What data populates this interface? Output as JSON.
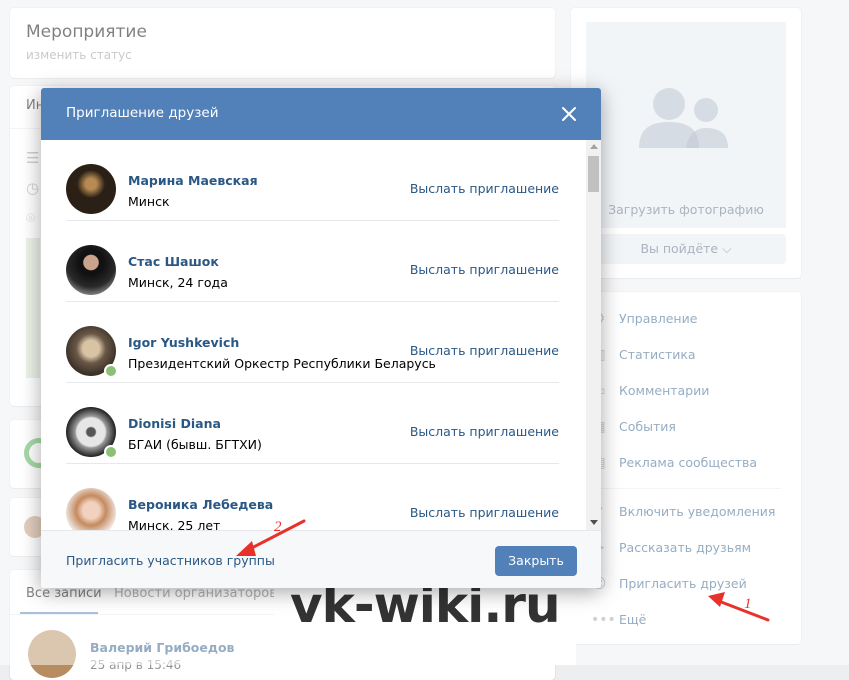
{
  "event": {
    "title": "Мероприятие",
    "status_link": "изменить статус",
    "info_prefix": "Ин"
  },
  "wall": {
    "tabs": [
      "Все записи",
      "Новости организаторов"
    ],
    "post_author": "Валерий Грибоедов",
    "post_date": "25 апр в 15:46"
  },
  "photo": {
    "upload_label": "Загрузить фотографию",
    "go_button": "Вы пойдёте ⌵"
  },
  "menu": {
    "items": [
      "Управление",
      "Статистика",
      "Комментарии",
      "События",
      "Реклама сообщества",
      "Включить уведомления",
      "Рассказать друзьям",
      "Пригласить друзей",
      "Ещё"
    ],
    "icons": [
      "gear-icon",
      "chart-icon",
      "comments-icon",
      "events-icon",
      "ads-icon",
      "bell-icon",
      "megaphone-icon",
      "add-user-icon",
      "more-icon"
    ]
  },
  "modal": {
    "title": "Приглашение друзей",
    "invite_group_link": "Пригласить участников группы",
    "close_button": "Закрыть",
    "friends": [
      {
        "name": "Марина Маевская",
        "subtitle": "Минск",
        "action": "Выслать приглашение",
        "online": false,
        "avatar_color": "#2b2016"
      },
      {
        "name": "Стас Шашок",
        "subtitle": "Минск, 24 года",
        "action": "Выслать приглашение",
        "online": false,
        "avatar_color": "#1c1c1c"
      },
      {
        "name": "Igor Yushkevich",
        "subtitle": "Президентский Оркестр Республики Беларусь",
        "action": "Выслать приглашение",
        "online": true,
        "avatar_color": "#8a7a68"
      },
      {
        "name": "Dionisi Diana",
        "subtitle": "БГАИ (бывш. БГТХИ)",
        "action": "Выслать приглашение",
        "online": true,
        "avatar_color": "#3a3a3a"
      },
      {
        "name": "Вероника Лебедева",
        "subtitle": "Минск, 25 лет",
        "action": "Выслать приглашение",
        "online": false,
        "avatar_color": "#d9a98a"
      }
    ]
  },
  "annotations": {
    "number_1": "1",
    "number_2": "2",
    "arrow_color": "#e8312a"
  },
  "watermark": {
    "text": "vk-wiki.ru"
  },
  "colors": {
    "accent": "#5181b8",
    "link": "#2a5885",
    "background": "#edeef0"
  }
}
